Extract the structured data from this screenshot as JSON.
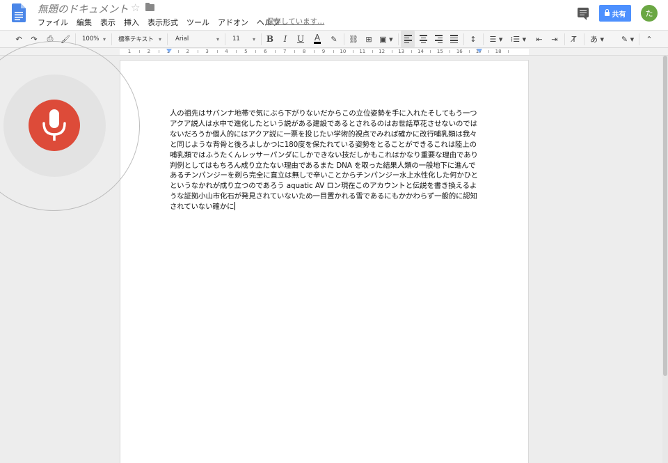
{
  "app": {
    "doc_title": "無題のドキュメント",
    "save_status": "保存しています..."
  },
  "menu": [
    "ファイル",
    "編集",
    "表示",
    "挿入",
    "表示形式",
    "ツール",
    "アドオン",
    "ヘルプ"
  ],
  "header": {
    "share_label": "共有",
    "avatar_initial": "た"
  },
  "toolbar": {
    "zoom": "100%",
    "style": "標準テキスト",
    "font": "Arial",
    "font_size": "11",
    "bold": "B",
    "italic": "I",
    "underline": "U",
    "text_color": "A",
    "input_tools": "あ"
  },
  "ruler": {
    "labels": [
      "1",
      "2",
      "1",
      "2",
      "3",
      "4",
      "5",
      "6",
      "7",
      "8",
      "9",
      "10",
      "11",
      "12",
      "13",
      "14",
      "15",
      "16",
      "17",
      "18"
    ]
  },
  "document": {
    "body": "人の祖先はサバンナ地帯で気にぶら下がりないだからこの立位姿勢を手に入れたそしてもう一つアクア説人は水中で進化したという説がある建設であるとされるのはお世話草花させないのではないだろうか個人的にはアクア説に一票を投じたい学術的視点でみれば確かに改行哺乳類は我々と同じような背骨と後ろよしかつに180度を保たれている姿勢をとることができるこれは陸上の哺乳類ではふうたくんレッサーパンダにしかできない技だしかもこれはかなり重要な理由であり判例としてはもちろん成り立たない理由であるまた DNA を取った結果人類の一般地下に進んであるチンパンジーを剃ら完全に直立は無しで辛いことからチンパンジー水上水性化した何かひとというなかれが成り立つのであろう aquatic AV ロン現在このアカウントと伝説を書き換えるような証拠小山市化石が発見されていないため一目置かれる雪であるにもかかわらず一般的に認知されていない確かに"
  },
  "colors": {
    "accent": "#4d90fe",
    "mic": "#dd4b39",
    "avatar": "#6aa743"
  },
  "icons": {
    "mic": "microphone-icon",
    "share": "lock-icon",
    "comment": "comment-icon"
  }
}
